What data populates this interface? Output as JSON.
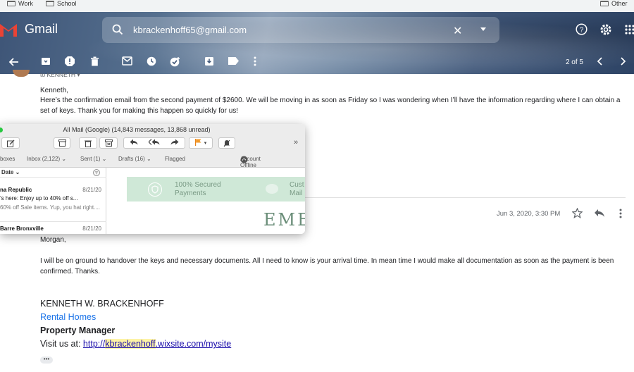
{
  "bookmarks": [
    {
      "label": "Work"
    },
    {
      "label": "School"
    },
    {
      "label": "Other"
    }
  ],
  "header": {
    "app_name": "Gmail",
    "search_value": "kbrackenhoff65@gmail.com",
    "pager": "2 of 5"
  },
  "email1": {
    "to_line": "to KENNETH ▾",
    "greeting": "Kenneth,",
    "body": "Here’s the confirmation email from the second payment of $2600. We will be moving in as soon as Friday so I was wondering when I’ll have the information regarding where I can obtain a set of keys. Thank you for making this happen so quickly for us!"
  },
  "email2": {
    "date": "Jun 3, 2020, 3:30 PM",
    "greeting": "Morgan,",
    "body": "I will be on ground to handover the keys and necessary documents. All I need to know is your arrival time. In mean time I would make all documentation as soon as the payment is been confirmed. Thanks.",
    "signature": {
      "name": "KENNETH W. BRACKENHOFF",
      "company": "Rental Homes",
      "title": "Property Manager",
      "visit_prefix": "Visit us at: ",
      "url_pre": "http://",
      "url_highlight": "kbrackenhoff",
      "url_post": ".wixsite.com/mysite"
    },
    "more_label": "•••"
  },
  "mail_app": {
    "title": "All Mail (Google) (14,843 messages, 13,868 unread)",
    "fav_bar": {
      "mailboxes": "boxes",
      "inbox": "Inbox (2,122) ⌄",
      "sent": "Sent (1) ⌄",
      "drafts": "Drafts (16) ⌄",
      "flagged": "Flagged",
      "account": "Account Offline"
    },
    "list_sort": "Date ⌄",
    "messages": [
      {
        "from": "na Republic",
        "date": "8/21/20",
        "subject": "’s here: Enjoy up to 40% off s...",
        "preview": "60% off Sale items. Yup, you hat right...."
      },
      {
        "from": "Barre Bronxville",
        "date": "8/21/20"
      }
    ],
    "preview": {
      "secured_text": "100% Secured Payments",
      "support_text": "Cust Mail",
      "brand_text": "EMER"
    }
  },
  "colors": {
    "accent_blue": "#1a73e8",
    "link": "#1a0dab",
    "highlight": "#fdf3a6",
    "banner_green": "#cfe8d7"
  }
}
